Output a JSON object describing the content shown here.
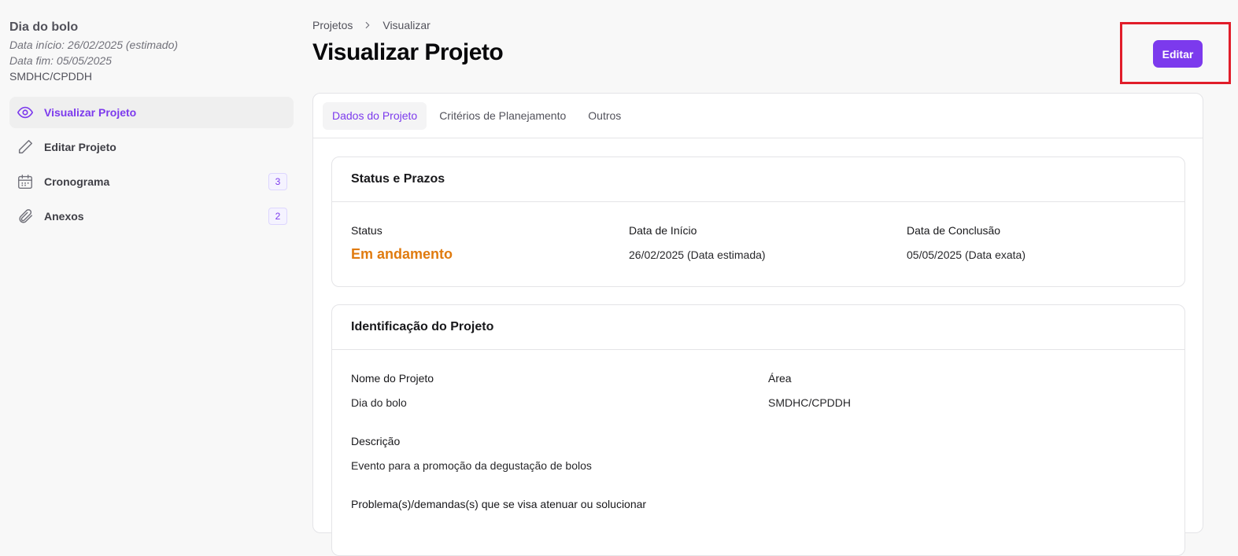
{
  "sidebar": {
    "project_title": "Dia do bolo",
    "start_date": "Data início: 26/02/2025 (estimado)",
    "end_date": "Data fim: 05/05/2025",
    "area": "SMDHC/CPDDH",
    "items": [
      {
        "label": "Visualizar Projeto",
        "icon": "eye-icon",
        "active": true
      },
      {
        "label": "Editar Projeto",
        "icon": "pencil-icon"
      },
      {
        "label": "Cronograma",
        "icon": "calendar-icon",
        "badge": "3"
      },
      {
        "label": "Anexos",
        "icon": "paperclip-icon",
        "badge": "2"
      }
    ]
  },
  "header": {
    "breadcrumb": [
      "Projetos",
      "Visualizar"
    ],
    "title": "Visualizar Projeto",
    "edit_label": "Editar"
  },
  "tabs": [
    "Dados do Projeto",
    "Critérios de Planejamento",
    "Outros"
  ],
  "status_card": {
    "title": "Status e Prazos",
    "status_label": "Status",
    "status_value": "Em andamento",
    "start_label": "Data de Início",
    "start_value": "26/02/2025 (Data estimada)",
    "end_label": "Data de Conclusão",
    "end_value": "05/05/2025 (Data exata)"
  },
  "ident_card": {
    "title": "Identificação do Projeto",
    "name_label": "Nome do Projeto",
    "name_value": "Dia do bolo",
    "area_label": "Área",
    "area_value": "SMDHC/CPDDH",
    "desc_label": "Descrição",
    "desc_value": "Evento para a promoção da degustação de bolos",
    "problem_label": "Problema(s)/demandas(s) que se visa atenuar ou solucionar"
  },
  "colors": {
    "accent": "#7c3aed",
    "status": "#e07b0f",
    "highlight": "#e11d2a"
  }
}
